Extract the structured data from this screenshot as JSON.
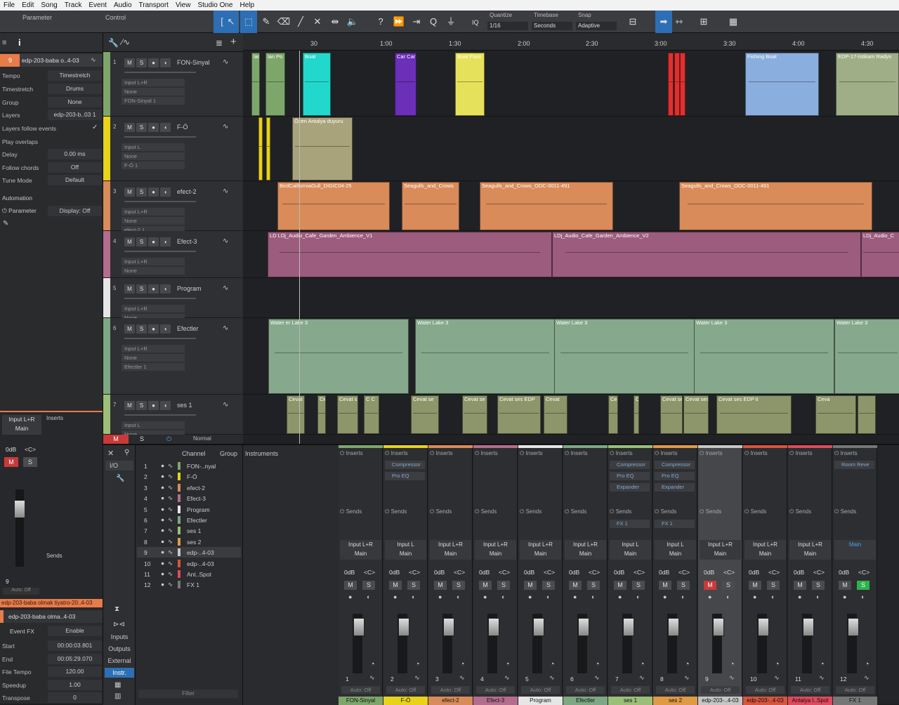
{
  "menu": [
    "File",
    "Edit",
    "Song",
    "Track",
    "Event",
    "Audio",
    "Transport",
    "View",
    "Studio One",
    "Help"
  ],
  "toolbar": {
    "parameter": "Parameter",
    "control": "Control",
    "iq": "IQ",
    "quantize_label": "Quantize",
    "quantize": "1/16",
    "timebase_label": "Timebase",
    "timebase": "Seconds",
    "snap_label": "Snap",
    "snap": "Adaptive"
  },
  "inspector": {
    "track_num": "9",
    "track_name": "edp-203-baba o..4-03",
    "rows": [
      {
        "k": "Tempo",
        "v": "Timestretch"
      },
      {
        "k": "Timestretch",
        "v": "Drums"
      },
      {
        "k": "Group",
        "v": "None"
      },
      {
        "k": "Layers",
        "v": "edp-203-b..03 1"
      },
      {
        "k": "Layers follow events",
        "v": ""
      },
      {
        "k": "Play overlaps",
        "v": ""
      },
      {
        "k": "Delay",
        "v": "0.00 ms"
      },
      {
        "k": "Follow chords",
        "v": "Off"
      },
      {
        "k": "Tune Mode",
        "v": "Default"
      }
    ],
    "automation": "Automation",
    "parameter": "Parameter",
    "display": "Display: Off",
    "ch_input": "Input L+R",
    "ch_main": "Main",
    "ch_db": "0dB",
    "ch_pan": "<C>",
    "ch_num": "9",
    "ch_auto": "Auto: Off",
    "inserts": "Inserts",
    "sends": "Sends",
    "event_bar": "edp-203-baba olmak tiyatro-20..4-03",
    "event_name": "edp-203-baba olma..4-03",
    "event_fx": "Event FX",
    "enable": "Enable",
    "event_rows": [
      {
        "k": "Start",
        "v": "00:00:03.801"
      },
      {
        "k": "End",
        "v": "00:05:29.070"
      },
      {
        "k": "File Tempo",
        "v": "120.00"
      },
      {
        "k": "Speedup",
        "v": "1.00"
      },
      {
        "k": "Transpose",
        "v": "0"
      }
    ]
  },
  "tracks": [
    {
      "n": "1",
      "name": "FON-Sinyal",
      "io": [
        "Input L+R",
        "None",
        "FON-Sinyal 1"
      ],
      "color": "#7da66b"
    },
    {
      "n": "2",
      "name": "F-Ö",
      "io": [
        "Input L",
        "None",
        "F-Ö 1"
      ],
      "color": "#e8d21a"
    },
    {
      "n": "3",
      "name": "efect-2",
      "io": [
        "Input L+R",
        "None",
        "efect-2 1"
      ],
      "color": "#d98b5a"
    },
    {
      "n": "4",
      "name": "Efect-3",
      "io": [
        "Input L+R",
        "None"
      ],
      "color": "#b56d8f"
    },
    {
      "n": "5",
      "name": "Program",
      "io": [
        "Input L+R",
        "None"
      ],
      "color": "#e6e6e6"
    },
    {
      "n": "6",
      "name": "Efectler",
      "io": [
        "Input L+R",
        "None",
        "Efectler 1"
      ],
      "color": "#7da884"
    },
    {
      "n": "7",
      "name": "ses 1",
      "io": [
        "Input L",
        "None"
      ],
      "color": "#9bbf78"
    }
  ],
  "msn": {
    "m": "M",
    "s": "S"
  },
  "ruler": [
    "30",
    "1:00",
    "1:30",
    "2:00",
    "2:30",
    "3:00",
    "3:30",
    "4:00",
    "4:30"
  ],
  "clips": {
    "t1": [
      "lan",
      "lan Po",
      "Boat",
      "Car Car",
      "Boat Pass",
      "Fishing Boat",
      "EDP-17-İstikam Radyo"
    ],
    "t2": [
      "Özen Antalya duyuru"
    ],
    "t3": [
      "BirdCaliforniaGull_DIGIC04-25",
      "Seagulls_and_Crows",
      "Seagulls_and_Crows_ODC-0011-491",
      "Seagulls_and_Crows_ODC-0011-491"
    ],
    "t4": [
      "LD LDj_Audio_Cafe_Garden_Ambience_V1",
      "LDj_Audio_Cafe_Garden_Ambience_V2",
      "LDj_Audio_C"
    ],
    "t6": [
      "Water er Lake 3",
      "Water Lake 3",
      "Water Lake 3",
      "Water Lake 3",
      "Water Lake 3"
    ],
    "t7": [
      "Cevat",
      "Ce",
      "Cevat s",
      "C C",
      "Cevat se",
      "Cevat se",
      "Cevat ses EDP",
      "Cevat",
      "Ce",
      "Cevat",
      "Cevat se",
      "Cevat ses EDP tiyatro -yazı",
      "Cevat ses EDP ti",
      "Ceva"
    ]
  },
  "footer": {
    "m": "M",
    "s": "S",
    "normal": "Normal"
  },
  "browser": {
    "io": "I/O",
    "channel": "Channel",
    "group": "Group",
    "instruments": "Instruments",
    "inputs": "Inputs",
    "outputs": "Outputs",
    "external": "External",
    "instr": "Instr.",
    "filter": "Filter",
    "rows": [
      {
        "n": "1",
        "name": "FON-..nyal",
        "c": "#7da66b"
      },
      {
        "n": "2",
        "name": "F-Ö",
        "c": "#e8d21a"
      },
      {
        "n": "3",
        "name": "efect-2",
        "c": "#d98b5a"
      },
      {
        "n": "4",
        "name": "Efect-3",
        "c": "#b56d8f"
      },
      {
        "n": "5",
        "name": "Program",
        "c": "#e6e6e6"
      },
      {
        "n": "6",
        "name": "Efectler",
        "c": "#7da884"
      },
      {
        "n": "7",
        "name": "ses 1",
        "c": "#9bbf78"
      },
      {
        "n": "8",
        "name": "ses 2",
        "c": "#e09a46"
      },
      {
        "n": "9",
        "name": "edp-..4-03",
        "c": "#c6c6c6"
      },
      {
        "n": "10",
        "name": "edp-..4-03",
        "c": "#d8553c"
      },
      {
        "n": "11",
        "name": "Ant..Spot",
        "c": "#e04a5c"
      },
      {
        "n": "12",
        "name": "FX 1",
        "c": "#777"
      }
    ]
  },
  "mixer": [
    {
      "top": "#7da66b",
      "plugins": [],
      "send": "",
      "inp": "Input L+R",
      "out": "Main",
      "n": "1",
      "name": "FON-Sinyal"
    },
    {
      "top": "#e8d21a",
      "plugins": [
        "Compressor",
        "Pro EQ"
      ],
      "send": "",
      "inp": "Input L",
      "out": "Main",
      "n": "2",
      "name": "F-Ö"
    },
    {
      "top": "#d98b5a",
      "plugins": [],
      "send": "",
      "inp": "Input L+R",
      "out": "Main",
      "n": "3",
      "name": "efect-2"
    },
    {
      "top": "#b56d8f",
      "plugins": [],
      "send": "",
      "inp": "Input L+R",
      "out": "Main",
      "n": "4",
      "name": "Efect-3"
    },
    {
      "top": "#e6e6e6",
      "plugins": [],
      "send": "",
      "inp": "Input L+R",
      "out": "Main",
      "n": "5",
      "name": "Program"
    },
    {
      "top": "#7da884",
      "plugins": [],
      "send": "",
      "inp": "Input L+R",
      "out": "Main",
      "n": "6",
      "name": "Efectler"
    },
    {
      "top": "#9bbf78",
      "plugins": [
        "Compressor",
        "Pro EQ",
        "Expander"
      ],
      "send": "FX 1",
      "inp": "Input L",
      "out": "Main",
      "n": "7",
      "name": "ses 1"
    },
    {
      "top": "#e09a46",
      "plugins": [
        "Compressor",
        "Pro EQ",
        "Expander"
      ],
      "send": "FX 1",
      "inp": "Input L",
      "out": "Main",
      "n": "8",
      "name": "ses 2"
    },
    {
      "top": "#c6c6c6",
      "plugins": [],
      "send": "",
      "inp": "Input L+R",
      "out": "Main",
      "n": "9",
      "name": "edp-203-..4-03"
    },
    {
      "top": "#d8553c",
      "plugins": [],
      "send": "",
      "inp": "Input L+R",
      "out": "Main",
      "n": "10",
      "name": "edp-203-..4-03"
    },
    {
      "top": "#e04a5c",
      "plugins": [],
      "send": "",
      "inp": "Input L+R",
      "out": "Main",
      "n": "11",
      "name": "Antalya I..Spot"
    },
    {
      "top": "#777777",
      "plugins": [
        "Room Reve"
      ],
      "send": "",
      "inp": "",
      "out": "Main",
      "n": "12",
      "name": "FX 1"
    }
  ],
  "mixer_labels": {
    "inserts": "Inserts",
    "sends": "Sends",
    "db": "0dB",
    "pan": "<C>",
    "m": "M",
    "s": "S",
    "auto": "Auto: Off",
    "fx": "FX"
  }
}
